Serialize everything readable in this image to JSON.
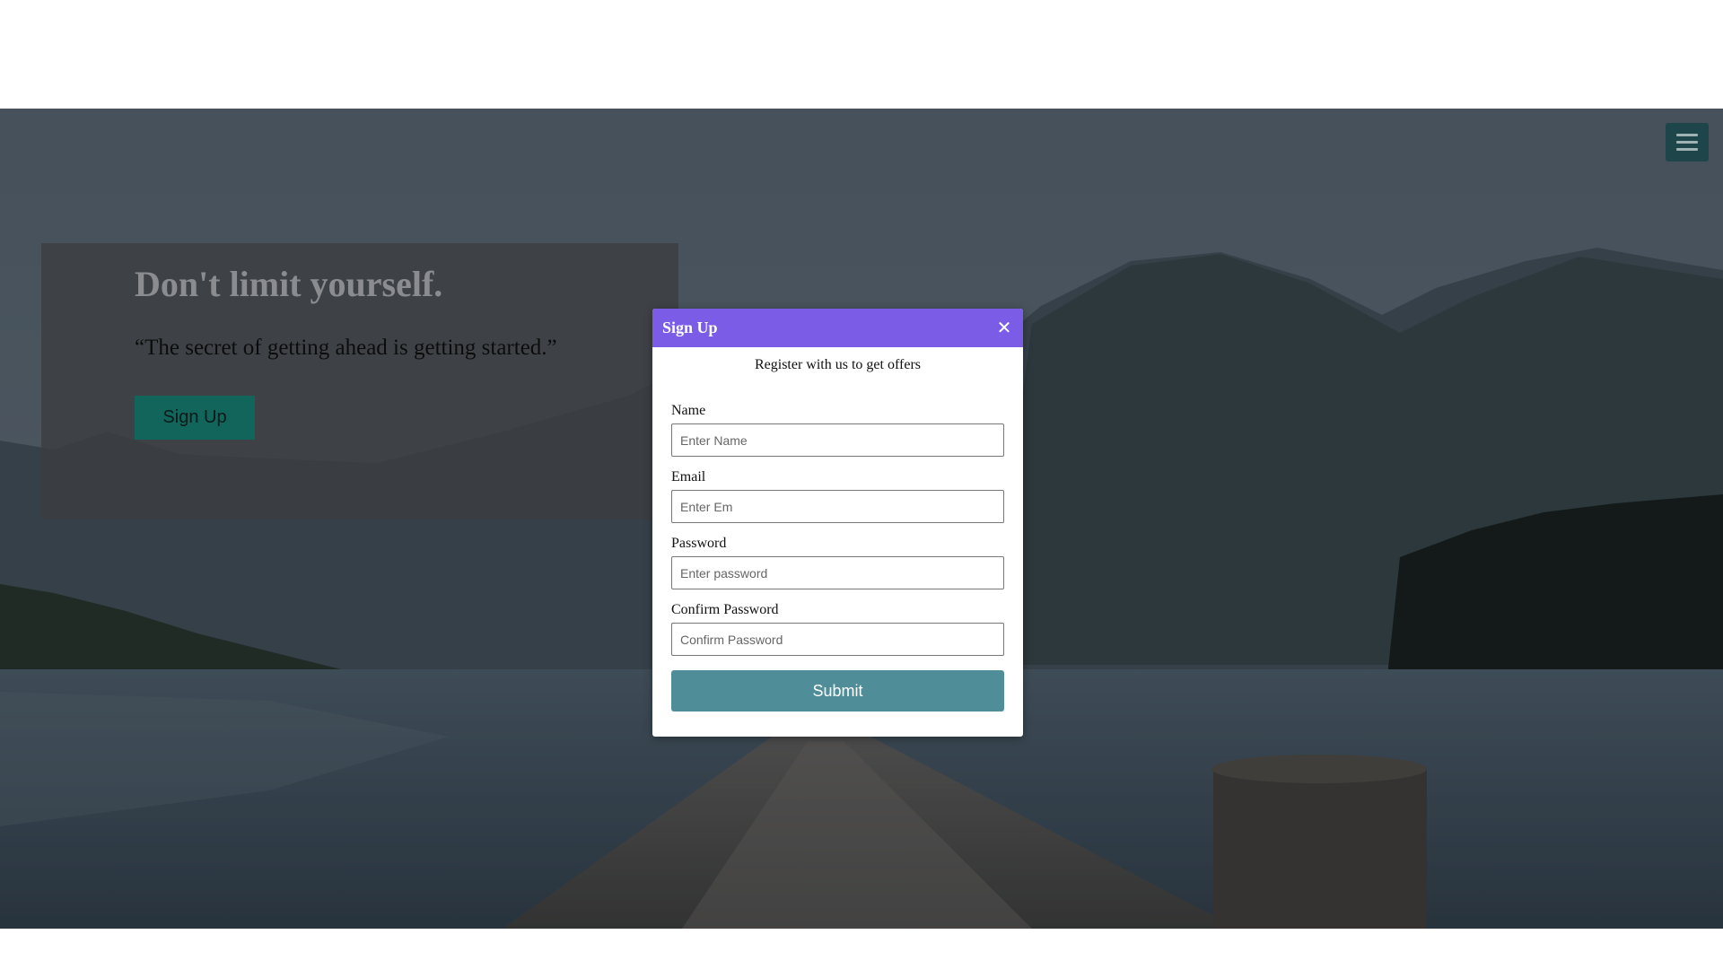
{
  "hero": {
    "heading": "Don't limit yourself.",
    "quote": "“The secret of getting ahead is getting started.”",
    "cta_label": "Sign Up"
  },
  "menu": {
    "icon": "hamburger-menu-icon"
  },
  "modal": {
    "title": "Sign Up",
    "close_icon": "close-icon",
    "subtitle": "Register with us to get offers",
    "fields": {
      "name": {
        "label": "Name",
        "placeholder": "Enter Name",
        "value": ""
      },
      "email": {
        "label": "Email",
        "placeholder": "Enter Em",
        "value": ""
      },
      "password": {
        "label": "Password",
        "placeholder": "Enter password",
        "value": ""
      },
      "confirm": {
        "label": "Confirm Password",
        "placeholder": "Confirm Password",
        "value": ""
      }
    },
    "submit_label": "Submit"
  },
  "colors": {
    "modal_header": "#7b5ce6",
    "submit_button": "#4f8e99",
    "cta_button": "#11655b",
    "menu_button": "#1e464a"
  }
}
